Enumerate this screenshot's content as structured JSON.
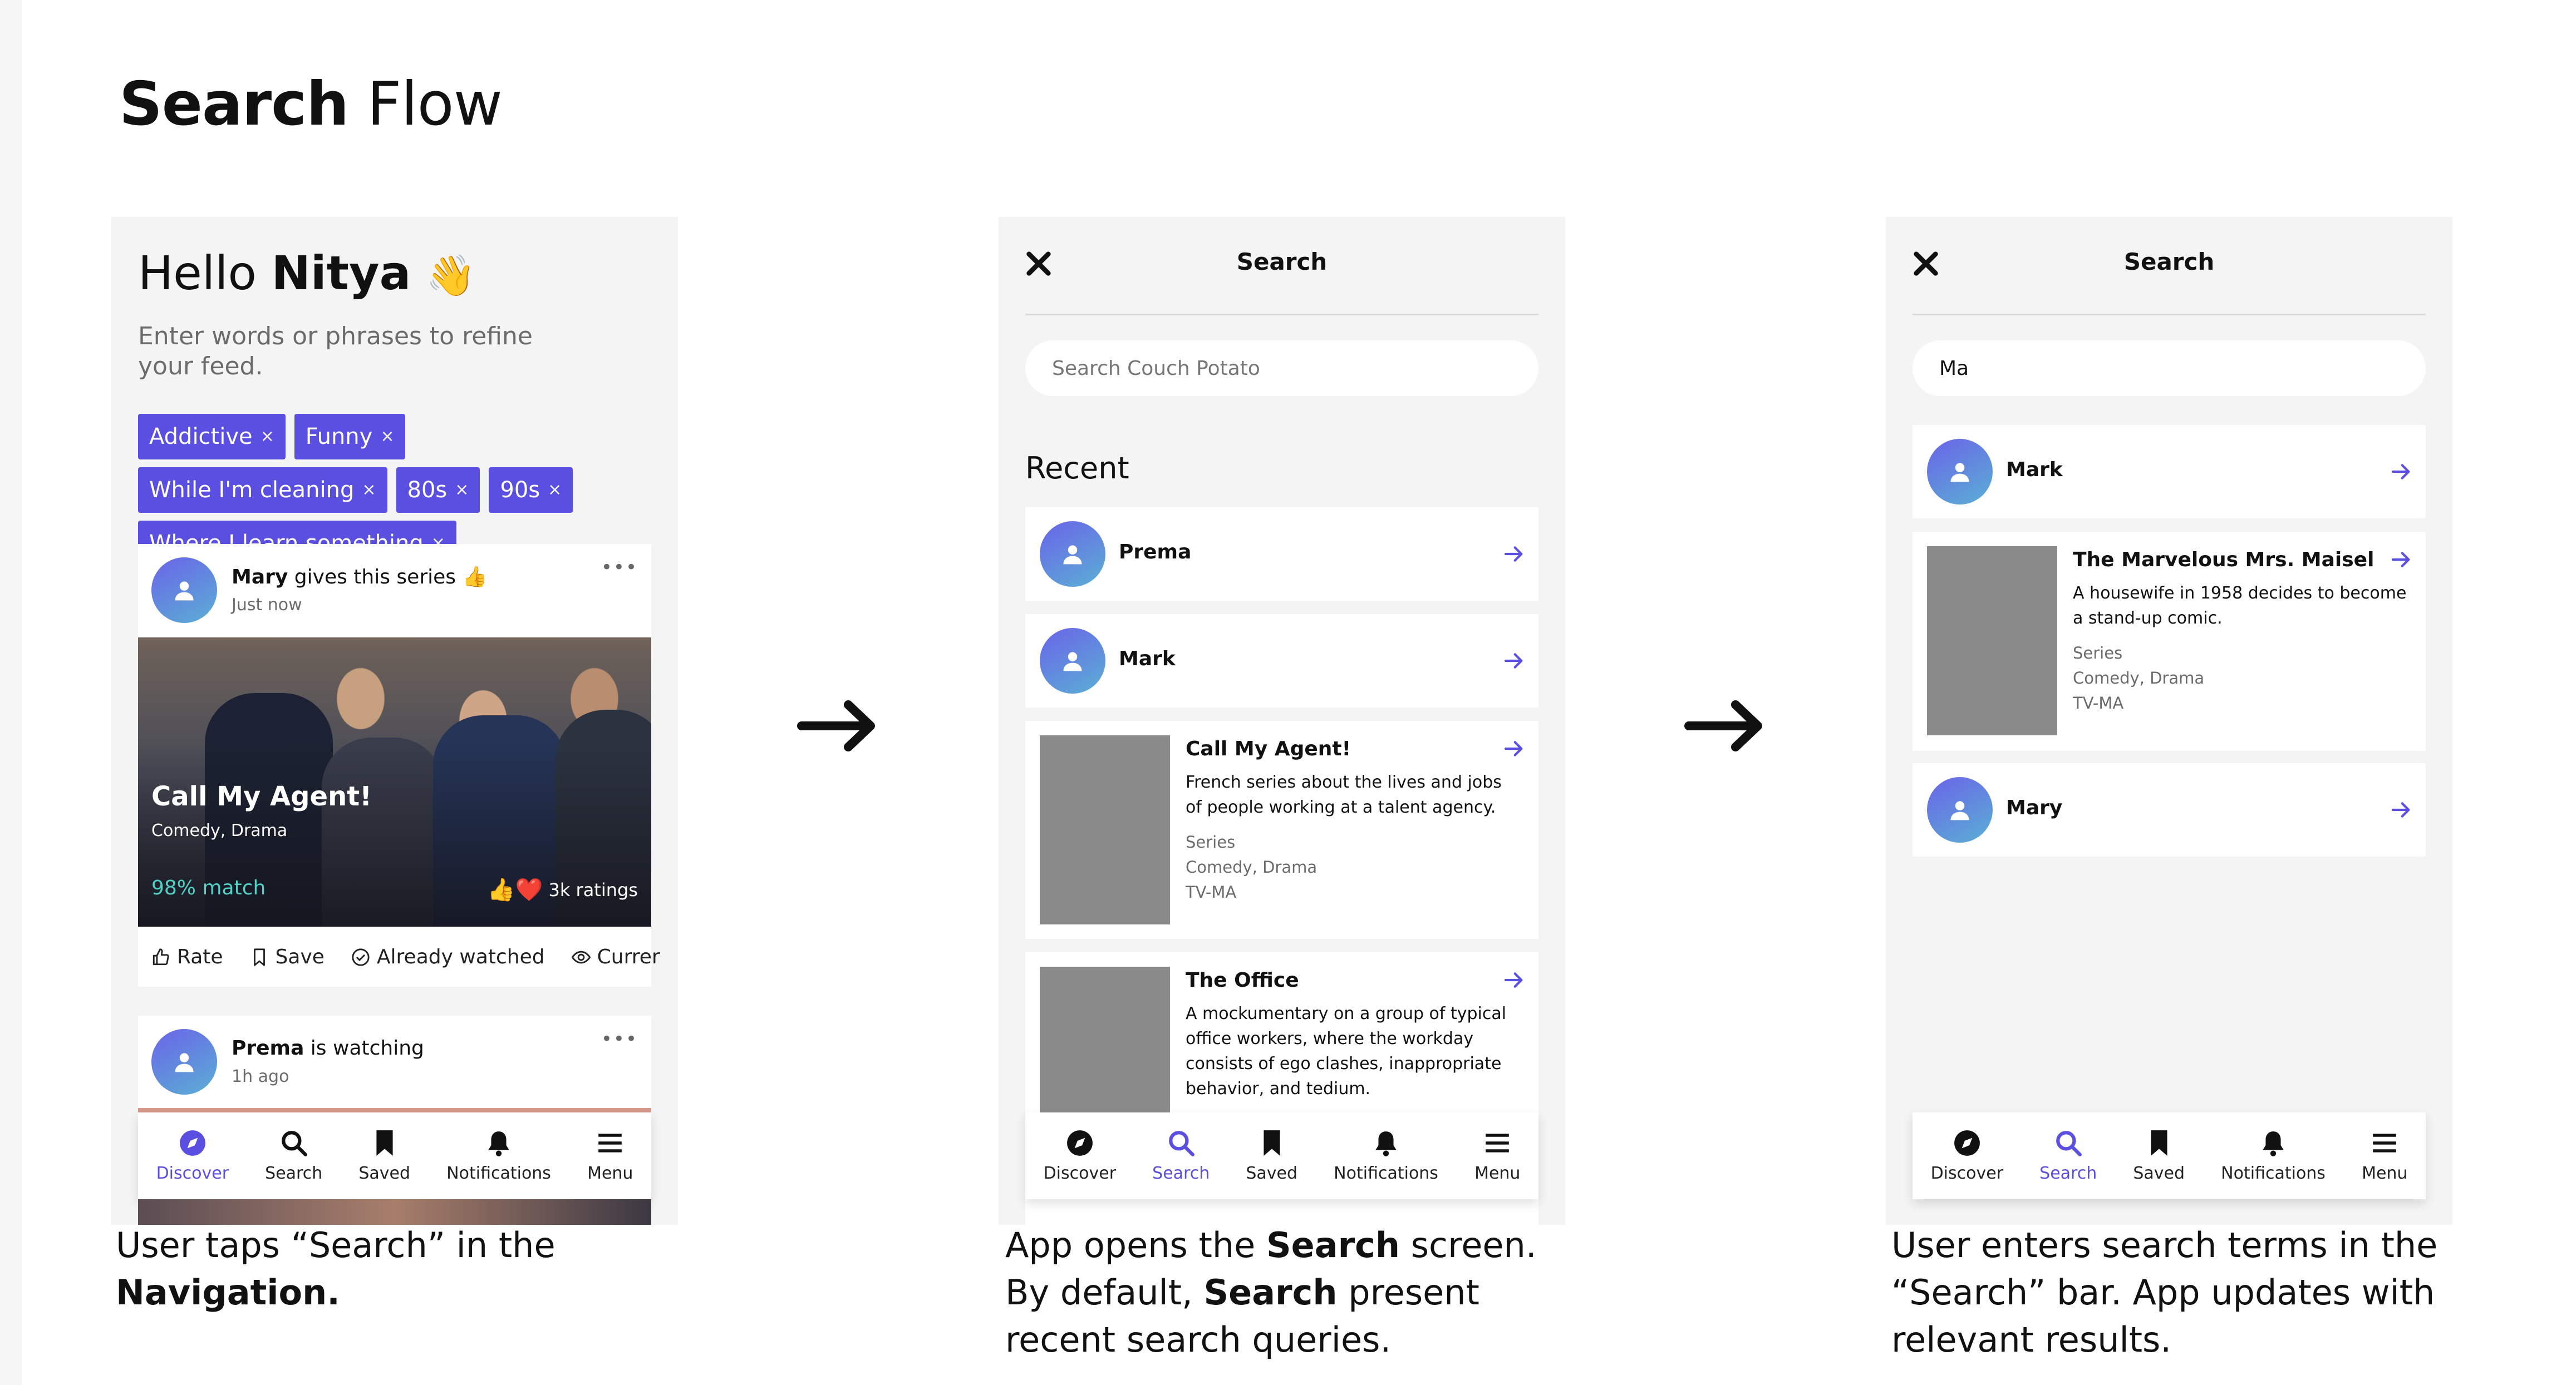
{
  "page": {
    "title_bold": "Search",
    "title_rest": " Flow"
  },
  "screen1": {
    "greeting_prefix": "Hello ",
    "greeting_name": "Nitya",
    "greeting_emoji": "👋",
    "prompt": "Enter words or phrases to refine your feed.",
    "chips": [
      "Addictive",
      "Funny",
      "While I'm cleaning",
      "80s",
      "90s",
      "Where I learn something"
    ],
    "chip_remove": "×",
    "post1": {
      "user": "Mary",
      "verb": " gives this series ",
      "emoji": "👍",
      "time": "Just now",
      "more": "•••",
      "show_title": "Call My Agent!",
      "genres": "Comedy, Drama",
      "match": "98% match",
      "rating_emoji": "👍❤️",
      "ratings": "3k ratings",
      "actions": {
        "rate": "Rate",
        "save": "Save",
        "watched": "Already watched",
        "current": "Currer"
      }
    },
    "post2": {
      "user": "Prema",
      "verb": " is watching",
      "time": "1h ago",
      "more": "•••"
    }
  },
  "nav": {
    "items": [
      "Discover",
      "Search",
      "Saved",
      "Notifications",
      "Menu"
    ]
  },
  "screen2": {
    "title": "Search",
    "placeholder": "Search Couch Potato",
    "recent_label": "Recent",
    "people": [
      "Prema",
      "Mark"
    ],
    "results": [
      {
        "title": "Call My Agent!",
        "desc": "French series about the lives and jobs of people working at a talent agency.",
        "type": "Series",
        "genres": "Comedy, Drama",
        "rating": "TV-MA"
      },
      {
        "title": "The Office",
        "desc": "A mockumentary on a group of typical office workers, where the workday consists of ego clashes, inappropriate behavior, and tedium."
      }
    ]
  },
  "screen3": {
    "title": "Search",
    "query": "Ma",
    "people": [
      "Mark",
      "Mary"
    ],
    "result": {
      "title": "The Marvelous Mrs. Maisel",
      "desc": "A housewife in 1958 decides to become a stand-up comic.",
      "type": "Series",
      "genres": "Comedy, Drama",
      "rating": "TV-MA"
    }
  },
  "captions": {
    "c1_a": "User taps “Search” in the ",
    "c1_b": "Navigation.",
    "c2_a": "App opens the ",
    "c2_b": "Search",
    "c2_c": " screen. By default, ",
    "c2_d": "Search",
    "c2_e": " present recent search queries.",
    "c3": "User enters search terms in the “Search” bar. App updates with relevant results."
  },
  "colors": {
    "accent": "#5a4fe0",
    "match": "#4fd1c5",
    "screen_bg": "#f4f4f4",
    "thumb": "#8a8a8a"
  },
  "icons": [
    "close-icon",
    "arrow-right-icon",
    "user-icon",
    "compass-icon",
    "search-icon",
    "bookmark-icon",
    "bell-icon",
    "menu-icon",
    "thumbs-up-icon",
    "check-circle-icon",
    "eye-icon"
  ]
}
